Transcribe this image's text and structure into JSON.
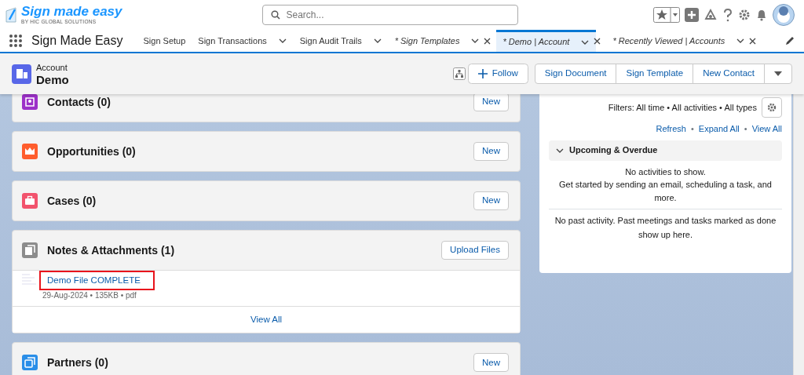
{
  "app": {
    "logo_title": "Sign made easy",
    "logo_subtitle": "BY HIC GLOBAL SOLUTIONS"
  },
  "search": {
    "placeholder": "Search..."
  },
  "nav": {
    "app_name": "Sign Made Easy",
    "items": [
      {
        "label": "Sign Setup",
        "kind": "link",
        "selected": false
      },
      {
        "label": "Sign Transactions",
        "kind": "menu",
        "selected": false
      },
      {
        "label": "Sign Audit Trails",
        "kind": "menu",
        "selected": false
      },
      {
        "label": "* Sign Templates",
        "kind": "tab",
        "selected": false
      },
      {
        "label": "* Demo | Account",
        "kind": "tab",
        "selected": true
      },
      {
        "label": "* Recently Viewed | Accounts",
        "kind": "tab",
        "selected": false
      }
    ]
  },
  "record": {
    "object": "Account",
    "name": "Demo",
    "actions": [
      {
        "label": "Follow",
        "kind": "follow"
      },
      {
        "label": "Sign Document",
        "kind": "group"
      },
      {
        "label": "Sign Template",
        "kind": "group"
      },
      {
        "label": "New Contact",
        "kind": "group"
      }
    ]
  },
  "related": [
    {
      "title": "Contacts (0)",
      "kind": "contacts",
      "color": "#9c30c8",
      "button": "New"
    },
    {
      "title": "Opportunities (0)",
      "kind": "opportunities",
      "color": "#ff5d2d",
      "button": "New"
    },
    {
      "title": "Cases (0)",
      "kind": "cases",
      "color": "#f2536d",
      "button": "New"
    },
    {
      "title": "Notes & Attachments (1)",
      "kind": "notes",
      "color": "#8c8c8c",
      "button": "Upload Files",
      "files": [
        {
          "title": "Demo File COMPLETE",
          "meta": "29-Aug-2024 • 135KB • pdf",
          "highlighted": true
        }
      ],
      "footer": "View All"
    },
    {
      "title": "Partners (0)",
      "kind": "partners",
      "color": "#2a8ee8",
      "button": "New"
    }
  ],
  "activity": {
    "filters": "Filters: All time • All activities • All types",
    "separator": "•",
    "links": [
      "Refresh",
      "Expand All",
      "View All"
    ],
    "section": {
      "title": "Upcoming & Overdue",
      "expanded": true,
      "empty_title": "No activities to show.",
      "empty_text": "Get started by sending an email, scheduling a task, and more."
    },
    "past": "No past activity. Past meetings and tasks marked as done show up here."
  }
}
